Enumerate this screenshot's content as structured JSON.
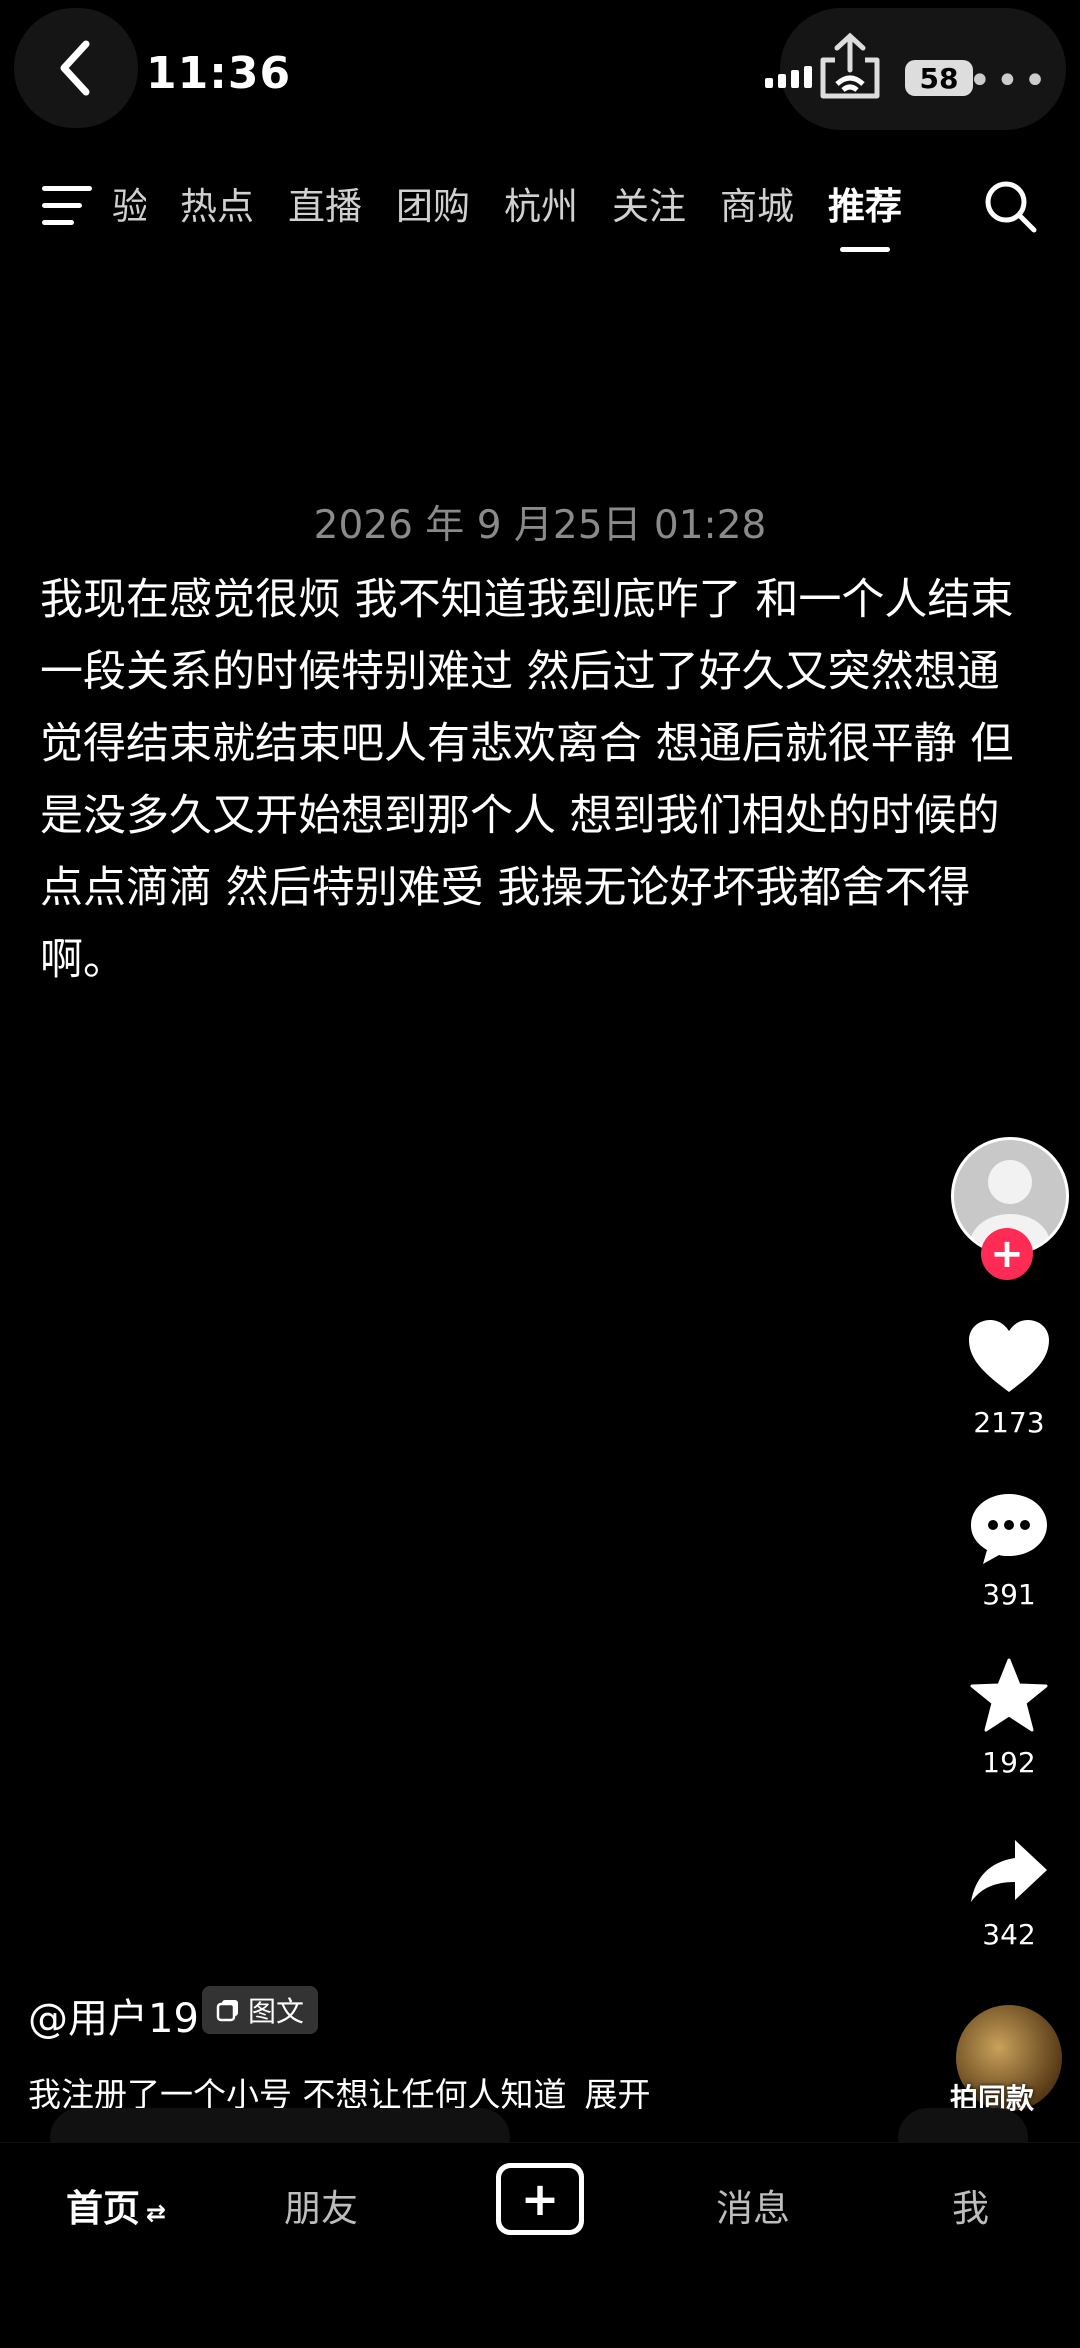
{
  "status_bar": {
    "time": "11:36",
    "battery": "58"
  },
  "nav": {
    "tabs": [
      "验",
      "热点",
      "直播",
      "团购",
      "杭州",
      "关注",
      "商城",
      "推荐"
    ],
    "active_tab": "推荐"
  },
  "post": {
    "date": "2026 年 9 月25日 01:28",
    "text": "我现在感觉很烦 我不知道我到底咋了 和一个人结束一段关系的时候特别难过 然后过了好久又突然想通觉得结束就结束吧人有悲欢离合 想通后就很平静 但是没多久又开始想到那个人 想到我们相处的时候的点点滴滴 然后特别难受 我操无论好坏我都舍不得啊。",
    "author": "@用户19",
    "type_badge": "图文",
    "caption": "我注册了一个小号 不想让任何人知道",
    "expand_label": "展开"
  },
  "actions": {
    "likes": "2173",
    "comments": "391",
    "favorites": "192",
    "shares": "342",
    "bgm_label": "拍同款"
  },
  "bottom_nav": {
    "home": "首页",
    "friends": "朋友",
    "messages": "消息",
    "me": "我"
  },
  "colors": {
    "accent": "#fe2c55",
    "background": "#000000"
  }
}
